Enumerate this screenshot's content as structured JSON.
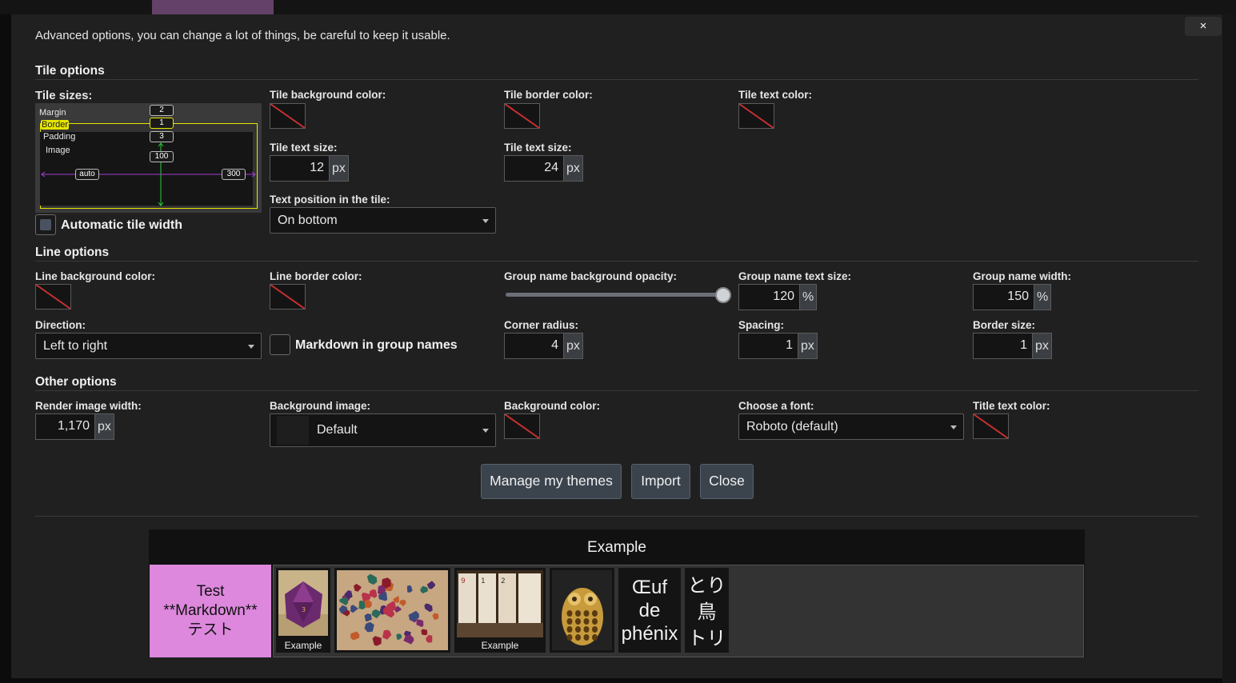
{
  "intro": "Advanced options, you can change a lot of things, be careful to keep it usable.",
  "close_x": "×",
  "tile_options": {
    "title": "Tile options",
    "sizes_label": "Tile sizes:",
    "diagram": {
      "margin_label": "Margin",
      "margin_value": "2",
      "border_label": "Border",
      "border_value": "1",
      "padding_label": "Padding",
      "padding_value": "3",
      "image_label": "Image",
      "image_value": "100",
      "width_min": "auto",
      "width_max": "300"
    },
    "auto_width_label": "Automatic tile width",
    "bg_color_label": "Tile background color:",
    "border_color_label": "Tile border color:",
    "text_color_label": "Tile text color:",
    "text_size_label_1": "Tile text size:",
    "text_size_value_1": "12",
    "text_size_label_2": "Tile text size:",
    "text_size_value_2": "24",
    "unit_px": "px",
    "text_position_label": "Text position in the tile:",
    "text_position_value": "On bottom"
  },
  "line_options": {
    "title": "Line options",
    "bg_color_label": "Line background color:",
    "border_color_label": "Line border color:",
    "group_opacity_label": "Group name background opacity:",
    "group_opacity_value": 1.0,
    "group_text_size_label": "Group name text size:",
    "group_text_size_value": "120",
    "group_width_label": "Group name width:",
    "group_width_value": "150",
    "unit_pct": "%",
    "direction_label": "Direction:",
    "direction_value": "Left to right",
    "markdown_label": "Markdown in group names",
    "corner_radius_label": "Corner radius:",
    "corner_radius_value": "4",
    "spacing_label": "Spacing:",
    "spacing_value": "1",
    "border_size_label": "Border size:",
    "border_size_value": "1"
  },
  "other_options": {
    "title": "Other options",
    "render_width_label": "Render image width:",
    "render_width_value": "1,170",
    "bg_image_label": "Background image:",
    "bg_image_value": "Default",
    "bg_color_label": "Background color:",
    "font_label": "Choose a font:",
    "font_value": "Roboto (default)",
    "title_color_label": "Title text color:"
  },
  "buttons": {
    "manage": "Manage my themes",
    "import": "Import",
    "close": "Close"
  },
  "preview": {
    "title": "Example",
    "group_name_lines": [
      "Test",
      "**Markdown**",
      "テスト"
    ],
    "tiles": [
      {
        "caption": "Example"
      },
      {
        "caption": ""
      },
      {
        "caption": "Example"
      },
      {
        "caption": ""
      },
      {
        "text_lines": [
          "Œuf",
          "de",
          "phénix"
        ]
      },
      {
        "text_lines": [
          "とり",
          "鳥",
          "トリ"
        ]
      }
    ]
  }
}
